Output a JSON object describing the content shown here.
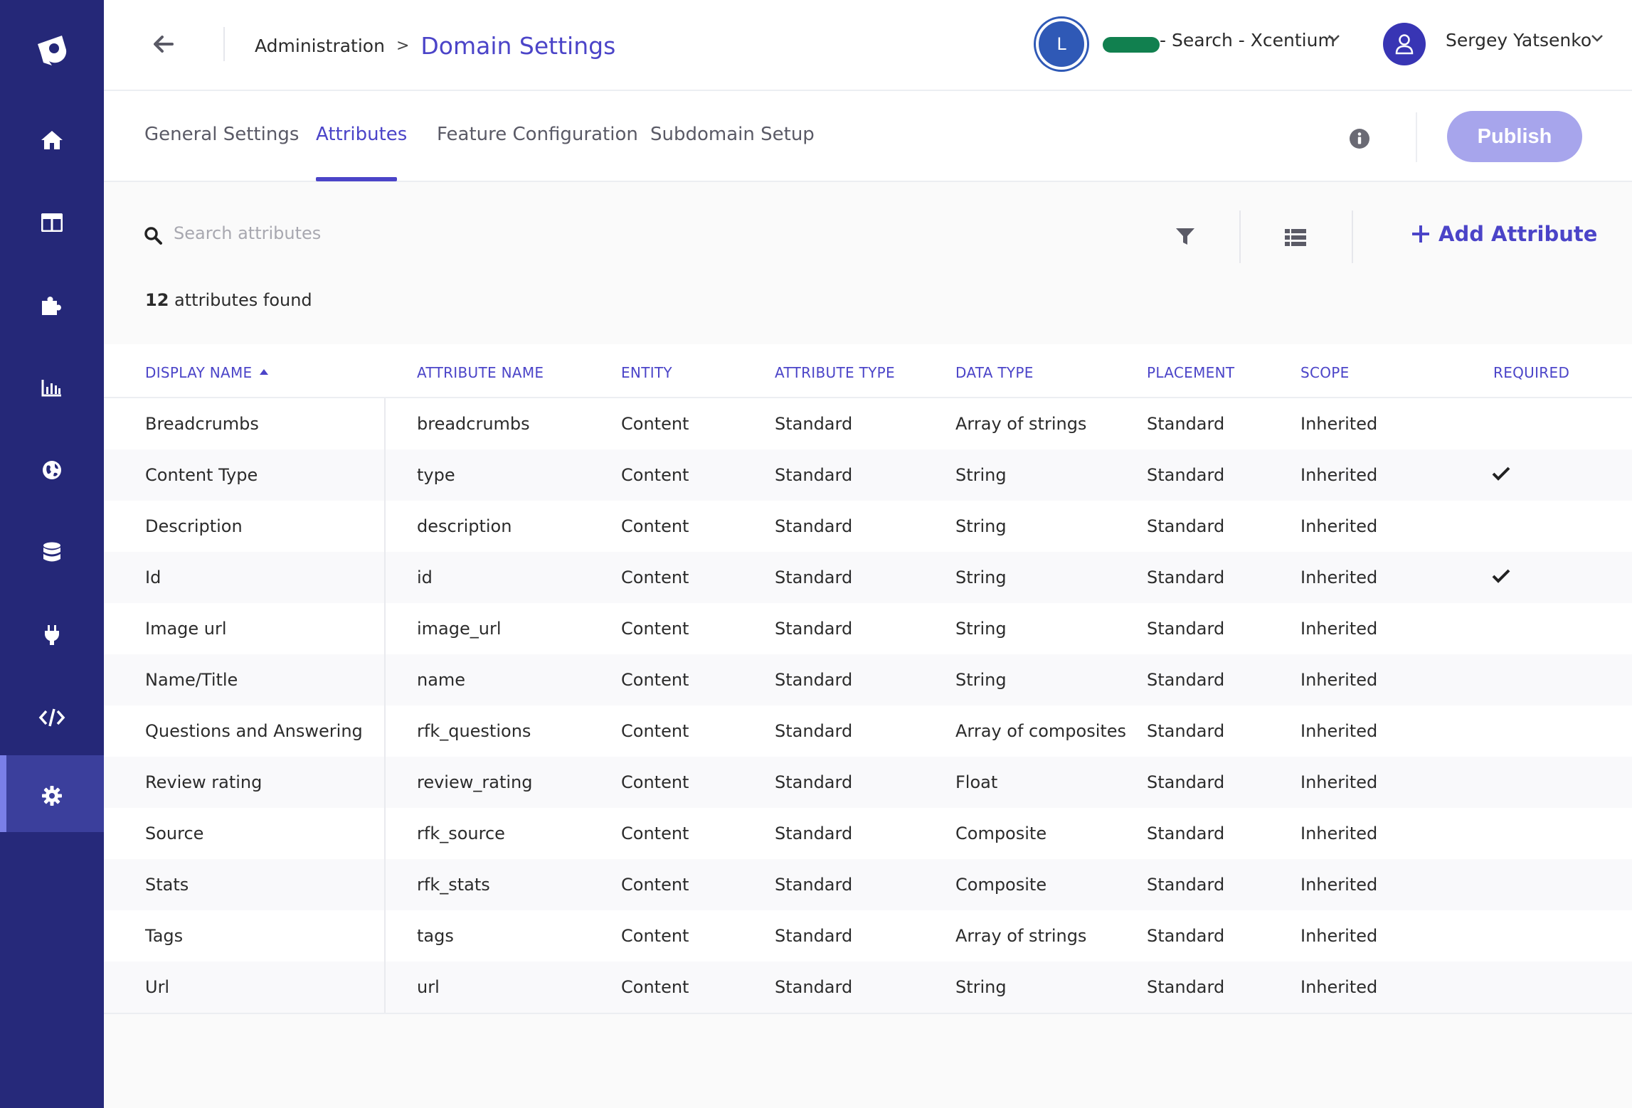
{
  "header": {
    "breadcrumb_parent": "Administration",
    "breadcrumb_separator": ">",
    "page_title": "Domain Settings",
    "domain_avatar_letter": "L",
    "domain_name": "- Search - Xcentium",
    "user_name": "Sergey Yatsenko"
  },
  "tabs": [
    {
      "label": "General Settings"
    },
    {
      "label": "Attributes"
    },
    {
      "label": "Feature Configuration"
    },
    {
      "label": "Subdomain Setup"
    }
  ],
  "publish_label": "Publish",
  "search": {
    "placeholder": "Search attributes",
    "value": ""
  },
  "add_attribute_label": "Add Attribute",
  "results": {
    "count": "12",
    "suffix": "attributes found"
  },
  "table": {
    "columns": [
      "DISPLAY NAME",
      "ATTRIBUTE NAME",
      "ENTITY",
      "ATTRIBUTE TYPE",
      "DATA TYPE",
      "PLACEMENT",
      "SCOPE",
      "REQUIRED"
    ],
    "sort_column": "DISPLAY NAME",
    "sort_direction": "ascending",
    "rows": [
      {
        "display": "Breadcrumbs",
        "attr": "breadcrumbs",
        "entity": "Content",
        "atype": "Standard",
        "dtype": "Array of strings",
        "placement": "Standard",
        "scope": "Inherited",
        "required": false
      },
      {
        "display": "Content Type",
        "attr": "type",
        "entity": "Content",
        "atype": "Standard",
        "dtype": "String",
        "placement": "Standard",
        "scope": "Inherited",
        "required": true
      },
      {
        "display": "Description",
        "attr": "description",
        "entity": "Content",
        "atype": "Standard",
        "dtype": "String",
        "placement": "Standard",
        "scope": "Inherited",
        "required": false
      },
      {
        "display": "Id",
        "attr": "id",
        "entity": "Content",
        "atype": "Standard",
        "dtype": "String",
        "placement": "Standard",
        "scope": "Inherited",
        "required": true
      },
      {
        "display": "Image url",
        "attr": "image_url",
        "entity": "Content",
        "atype": "Standard",
        "dtype": "String",
        "placement": "Standard",
        "scope": "Inherited",
        "required": false
      },
      {
        "display": "Name/Title",
        "attr": "name",
        "entity": "Content",
        "atype": "Standard",
        "dtype": "String",
        "placement": "Standard",
        "scope": "Inherited",
        "required": false
      },
      {
        "display": "Questions and Answering",
        "attr": "rfk_questions",
        "entity": "Content",
        "atype": "Standard",
        "dtype": "Array of composites",
        "placement": "Standard",
        "scope": "Inherited",
        "required": false
      },
      {
        "display": "Review rating",
        "attr": "review_rating",
        "entity": "Content",
        "atype": "Standard",
        "dtype": "Float",
        "placement": "Standard",
        "scope": "Inherited",
        "required": false
      },
      {
        "display": "Source",
        "attr": "rfk_source",
        "entity": "Content",
        "atype": "Standard",
        "dtype": "Composite",
        "placement": "Standard",
        "scope": "Inherited",
        "required": false
      },
      {
        "display": "Stats",
        "attr": "rfk_stats",
        "entity": "Content",
        "atype": "Standard",
        "dtype": "Composite",
        "placement": "Standard",
        "scope": "Inherited",
        "required": false
      },
      {
        "display": "Tags",
        "attr": "tags",
        "entity": "Content",
        "atype": "Standard",
        "dtype": "Array of strings",
        "placement": "Standard",
        "scope": "Inherited",
        "required": false
      },
      {
        "display": "Url",
        "attr": "url",
        "entity": "Content",
        "atype": "Standard",
        "dtype": "String",
        "placement": "Standard",
        "scope": "Inherited",
        "required": false
      }
    ]
  },
  "sidebar": {
    "items": [
      {
        "icon": "home-icon"
      },
      {
        "icon": "layout-icon"
      },
      {
        "icon": "puzzle-icon"
      },
      {
        "icon": "bar-chart-icon"
      },
      {
        "icon": "globe-icon"
      },
      {
        "icon": "database-icon"
      },
      {
        "icon": "plug-icon"
      },
      {
        "icon": "code-icon"
      },
      {
        "icon": "gear-icon",
        "active": true
      }
    ]
  },
  "colors": {
    "sidebar": "#252878",
    "sidebar_active": "#3b3f9c",
    "accent": "#4b44c8",
    "publish_disabled": "#a7a5ec"
  }
}
